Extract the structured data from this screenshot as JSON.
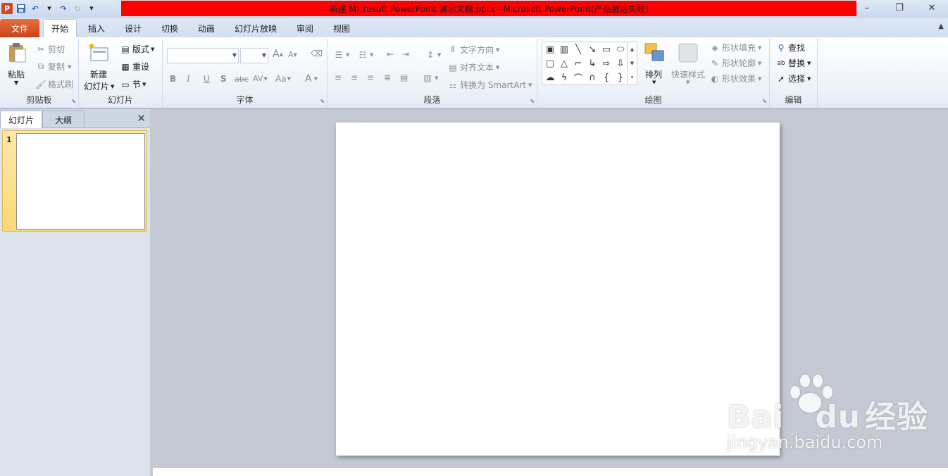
{
  "window": {
    "title": "新建 Microsoft PowerPoint 演示文稿.pptx  -  Microsoft PowerPoint(产品激活失败)",
    "app_icon": "P",
    "title_bar_color": "#ff0000",
    "controls": {
      "minimize": "–",
      "restore": "❐",
      "close": "✕"
    }
  },
  "quick_access": {
    "save": "save-icon",
    "undo": "↶",
    "redo": "↷",
    "repeat": "↻"
  },
  "ribbon_tabs": [
    "文件",
    "开始",
    "插入",
    "设计",
    "切换",
    "动画",
    "幻灯片放映",
    "审阅",
    "视图"
  ],
  "active_tab": "开始",
  "groups": {
    "clipboard": {
      "label": "剪贴板",
      "paste": "粘贴",
      "cut": "剪切",
      "copy": "复制",
      "format_painter": "格式刷"
    },
    "slides": {
      "label": "幻灯片",
      "new_slide_1": "新建",
      "new_slide_2": "幻灯片",
      "layout": "版式",
      "reset": "重设",
      "section": "节"
    },
    "font": {
      "label": "字体",
      "font_name": "",
      "font_size": "",
      "bold": "B",
      "italic": "I",
      "underline": "U",
      "shadow": "S",
      "strike": "abc",
      "spacing": "AV",
      "case": "Aa",
      "color": "A",
      "grow": "A",
      "shrink": "A"
    },
    "paragraph": {
      "label": "段落",
      "text_direction": "文字方向",
      "align_text": "对齐文本",
      "convert_smartart": "转换为 SmartArt"
    },
    "drawing": {
      "label": "绘图",
      "arrange": "排列",
      "quick_styles": "快速样式",
      "shape_fill": "形状填充",
      "shape_outline": "形状轮廓",
      "shape_effects": "形状效果"
    },
    "editing": {
      "label": "编辑",
      "find": "查找",
      "replace": "替换",
      "select": "选择"
    }
  },
  "left_pane": {
    "tab_slides": "幻灯片",
    "tab_outline": "大纲",
    "close": "✕",
    "slide_number": "1"
  },
  "watermark": {
    "brand": "Bai",
    "brand2": "du",
    "cn": "经验",
    "url": "jingyan.baidu.com"
  }
}
